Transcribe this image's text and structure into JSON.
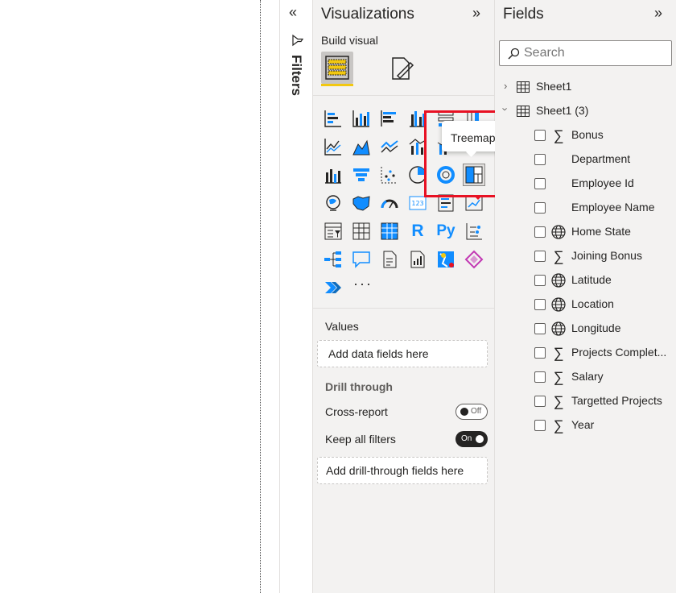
{
  "filters": {
    "label": "Filters"
  },
  "visualizations": {
    "title": "Visualizations",
    "build_visual_label": "Build visual",
    "values_label": "Values",
    "values_placeholder": "Add data fields here",
    "drill_through_label": "Drill through",
    "cross_report_label": "Cross-report",
    "cross_report_state": "Off",
    "keep_filters_label": "Keep all filters",
    "keep_filters_state": "On",
    "drill_placeholder": "Add drill-through fields here",
    "more_label": "···",
    "tooltip": "Treemap"
  },
  "fields": {
    "title": "Fields",
    "search_placeholder": "Search",
    "tables": [
      {
        "name": "Sheet1"
      },
      {
        "name": "Sheet1 (3)"
      }
    ],
    "items": [
      {
        "name": "Bonus",
        "type": "sum-icon"
      },
      {
        "name": "Department",
        "type": ""
      },
      {
        "name": "Employee Id",
        "type": ""
      },
      {
        "name": "Employee Name",
        "type": ""
      },
      {
        "name": "Home State",
        "type": "globe-icon"
      },
      {
        "name": "Joining Bonus",
        "type": "sum-icon"
      },
      {
        "name": "Latitude",
        "type": "globe-icon"
      },
      {
        "name": "Location",
        "type": "globe-icon"
      },
      {
        "name": "Longitude",
        "type": "globe-icon"
      },
      {
        "name": "Projects Complet...",
        "type": "sum-icon"
      },
      {
        "name": "Salary",
        "type": "sum-icon"
      },
      {
        "name": "Targetted Projects",
        "type": "sum-icon"
      },
      {
        "name": "Year",
        "type": "sum-icon"
      }
    ]
  },
  "colors": {
    "accent": "#118dff",
    "highlight": "#e81123",
    "yellow": "#f2c811"
  }
}
